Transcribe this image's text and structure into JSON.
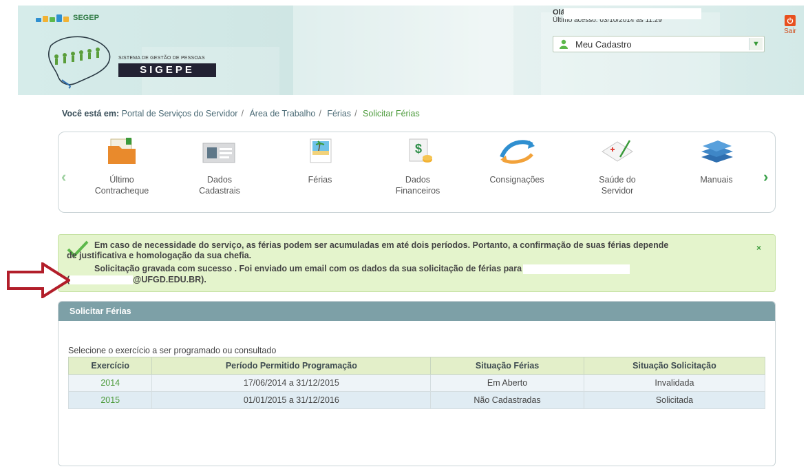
{
  "header": {
    "segep_label": "SEGEP",
    "system_subtitle": "SISTEMA DE GESTÃO DE PESSOAS",
    "system_name": "SIGEPE",
    "greeting": "Olá",
    "last_access": "Último acesso: 03/10/2014 às 11:29",
    "profile_select": "Meu Cadastro",
    "logout_label": "Sair"
  },
  "breadcrumb": {
    "lead": "Você está em:",
    "items": [
      "Portal de Serviços do Servidor",
      "Área de Trabalho",
      "Férias",
      "Solicitar Férias"
    ]
  },
  "carousel": {
    "items": [
      {
        "line1": "Último",
        "line2": "Contracheque",
        "icon": "folder-icon"
      },
      {
        "line1": "Dados",
        "line2": "Cadastrais",
        "icon": "id-card-icon"
      },
      {
        "line1": "Férias",
        "line2": "",
        "icon": "beach-photo-icon"
      },
      {
        "line1": "Dados",
        "line2": "Financeiros",
        "icon": "money-icon"
      },
      {
        "line1": "Consignações",
        "line2": "",
        "icon": "arrows-icon"
      },
      {
        "line1": "Saúde do",
        "line2": "Servidor",
        "icon": "health-card-icon"
      },
      {
        "line1": "Manuais",
        "line2": "",
        "icon": "books-icon"
      }
    ]
  },
  "message": {
    "line1": "Em caso de necessidade do serviço, as férias podem ser acumuladas em até dois períodos. Portanto, a confirmação de suas férias depende",
    "line2": "de justificativa e homologação da sua chefia.",
    "line3": "Solicitação gravada com sucesso . Foi enviado um email com os dados da sua solicitação de férias para",
    "line4_prefix": "(",
    "line4_suffix": "@UFGD.EDU.BR).",
    "close": "×"
  },
  "panel": {
    "title": "Solicitar Férias",
    "intro": "Selecione o exercício a ser programado ou consultado",
    "columns": [
      "Exercício",
      "Período Permitido Programação",
      "Situação Férias",
      "Situação Solicitação"
    ],
    "rows": [
      {
        "year": "2014",
        "period": "17/06/2014 a 31/12/2015",
        "vacation_status": "Em Aberto",
        "request_status": "Invalidada"
      },
      {
        "year": "2015",
        "period": "01/01/2015 a 31/12/2016",
        "vacation_status": "Não Cadastradas",
        "request_status": "Solicitada"
      }
    ]
  },
  "colors": {
    "brand_green": "#4b9a3a",
    "panel_header": "#7da0a7",
    "success_bg": "#e4f4cc",
    "logout_orange": "#e8501e",
    "callout_red": "#b21e2a"
  }
}
